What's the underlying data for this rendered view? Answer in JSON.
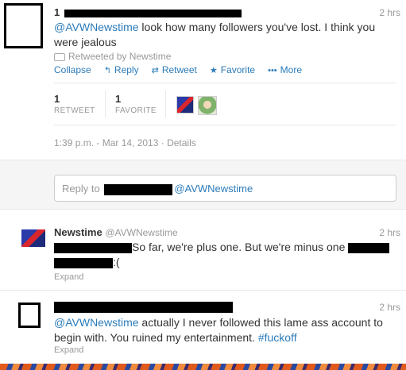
{
  "tweet1": {
    "time": "2 hrs",
    "mention": "@AVWNewstime",
    "text_rest": " look how many followers you've lost. I think you were jealous",
    "retweeted_by": "Retweeted by Newstime",
    "actions": {
      "collapse": "Collapse",
      "reply": "Reply",
      "retweet": "Retweet",
      "favorite": "Favorite",
      "more": "More"
    },
    "retweet_count": "1",
    "retweet_label": "RETWEET",
    "favorite_count": "1",
    "favorite_label": "FAVORITE",
    "timestamp": "1:39 p.m. - Mar 14, 2013",
    "details": "Details"
  },
  "reply": {
    "prefix": "Reply to",
    "mention": "@AVWNewstime"
  },
  "tweet2": {
    "name": "Newstime",
    "handle": "@AVWNewstime",
    "time": "2 hrs",
    "text_part1": "So far, we're plus one. But we're minus one",
    "text_part2": ":(",
    "expand": "Expand"
  },
  "tweet3": {
    "time": "2 hrs",
    "mention": "@AVWNewstime",
    "text_rest": " actually I never followed this lame ass account to begin with. You ruined my entertainment. ",
    "hashtag": "#fuckoff",
    "expand": "Expand"
  },
  "colors": {
    "link": "#2b7bb9",
    "muted": "#999999",
    "text": "#333333"
  },
  "icons": [
    "retweet-icon",
    "reply-icon",
    "star-icon",
    "more-dots-icon"
  ]
}
